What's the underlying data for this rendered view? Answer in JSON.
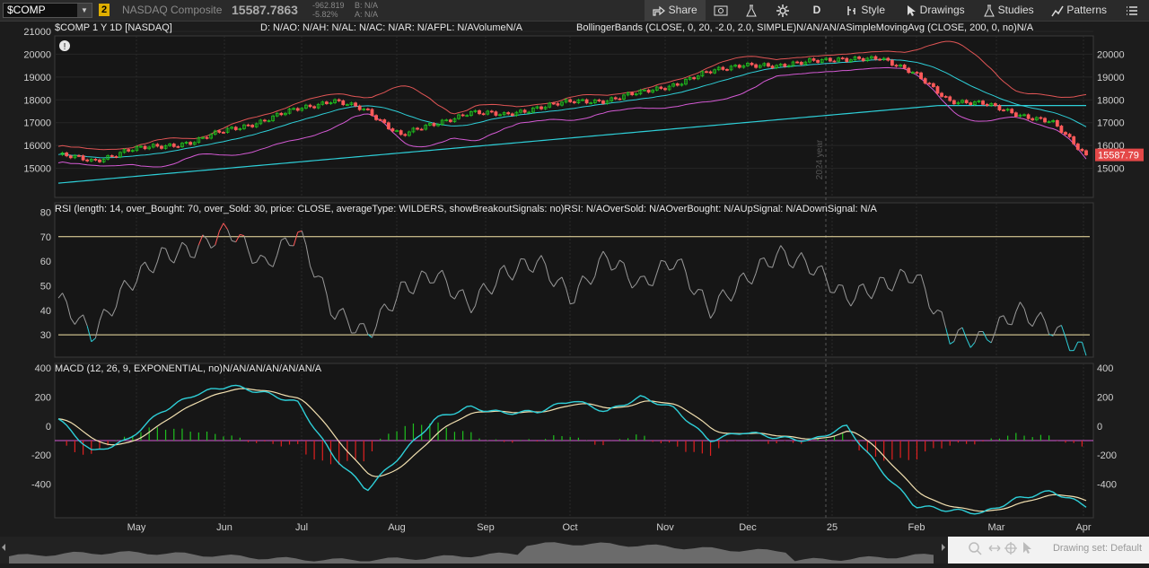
{
  "toolbar": {
    "symbol": "$COMP",
    "link_number": "2",
    "description": "NASDAQ Composite",
    "last_price": "15587.7863",
    "net_change": "-962.819",
    "pct_change": "-5.82%",
    "bid": "B: N/A",
    "ask": "A: N/A",
    "share_label": "Share",
    "timeframe_label": "D",
    "style_label": "Style",
    "drawings_label": "Drawings",
    "studies_label": "Studies",
    "patterns_label": "Patterns"
  },
  "price_pane": {
    "header": "$COMP 1 Y 1D [NASDAQ]",
    "quote_info": "D: N/AO: N/AH: N/AL: N/AC: N/AR: N/AFPL: N/AVolumeN/A",
    "bollinger_legend": "BollingerBands (CLOSE, 0, 20, -2.0, 2.0, SIMPLE)N/AN/AN/A",
    "sma_legend": "SimpleMovingAvg (CLOSE, 200, 0, no)N/A",
    "y_labels": [
      "21000",
      "20000",
      "19000",
      "18000",
      "17000",
      "16000",
      "15000"
    ],
    "right_y_labels": [
      "20000",
      "19000",
      "18000",
      "17000",
      "16000",
      "15000"
    ],
    "price_badge": "15587.79",
    "year_marker": "2024 year",
    "alert_icon": "exclamation-icon",
    "colors": {
      "up": "#1fc01f",
      "down": "#ff5a5a",
      "upper_band": "#e05555",
      "lower_band": "#d45ad4",
      "mid_band": "#2ecfd8",
      "sma": "#2ecfd8",
      "badge": "#e44848"
    }
  },
  "rsi_pane": {
    "legend": "RSI (length: 14, over_Bought: 70, over_Sold: 30, price: CLOSE, averageType: WILDERS, showBreakoutSignals: no)RSI: N/AOverSold: N/AOverBought: N/AUpSignal: N/ADownSignal: N/A",
    "y_labels": [
      "80",
      "70",
      "60",
      "50",
      "40",
      "30"
    ],
    "over_bought": 70,
    "over_sold": 30,
    "colors": {
      "line": "#999999",
      "ob": "#ff5a5a",
      "os": "#2ecfd8",
      "level": "#f5e6a8"
    }
  },
  "macd_pane": {
    "legend": "MACD (12, 26, 9, EXPONENTIAL, no)N/AN/AN/AN/AN/AN/A",
    "y_labels": [
      "400",
      "200",
      "0",
      "-200",
      "-400"
    ],
    "right_y_labels": [
      "400",
      "200",
      "0",
      "-200",
      "-400"
    ],
    "colors": {
      "macd": "#2ecfd8",
      "signal": "#f2e0b0",
      "hist_pos": "#1fc01f",
      "hist_neg": "#e02020",
      "zero": "#d45ad4"
    }
  },
  "x_axis": {
    "labels": [
      "May",
      "Jun",
      "Jul",
      "Aug",
      "Sep",
      "Oct",
      "Nov",
      "Dec",
      "25",
      "Feb",
      "Mar",
      "Apr"
    ]
  },
  "footer": {
    "drawing_set": "Drawing set: Default"
  },
  "chart_data": {
    "type": "candlestick",
    "title": "$COMP 1 Y 1D [NASDAQ]",
    "y_range": [
      14000,
      21000
    ],
    "months": [
      "May",
      "Jun",
      "Jul",
      "Aug",
      "Sep",
      "Oct",
      "Nov",
      "Dec",
      "25",
      "Feb",
      "Mar",
      "Apr"
    ],
    "close_approx": [
      15600,
      15300,
      15800,
      15950,
      16200,
      16700,
      17100,
      17600,
      18000,
      17500,
      16500,
      16900,
      17500,
      17300,
      17700,
      17900,
      18000,
      18300,
      18700,
      19200,
      19600,
      19400,
      19800,
      19700,
      19900,
      19100,
      18000,
      17800,
      17400,
      17000,
      15588
    ],
    "rsi_approx": [
      45,
      30,
      50,
      62,
      65,
      73,
      58,
      72,
      40,
      30,
      48,
      55,
      42,
      55,
      60,
      45,
      62,
      50,
      61,
      40,
      52,
      63,
      58,
      45,
      50,
      55,
      30,
      28,
      40,
      33,
      22
    ],
    "macd_approx": [
      50,
      -180,
      -100,
      100,
      220,
      280,
      230,
      160,
      -200,
      -440,
      -200,
      50,
      130,
      90,
      100,
      180,
      100,
      200,
      120,
      -100,
      -40,
      -80,
      -100,
      0,
      -300,
      -550,
      -580,
      -600,
      -500,
      -450,
      -550
    ]
  }
}
